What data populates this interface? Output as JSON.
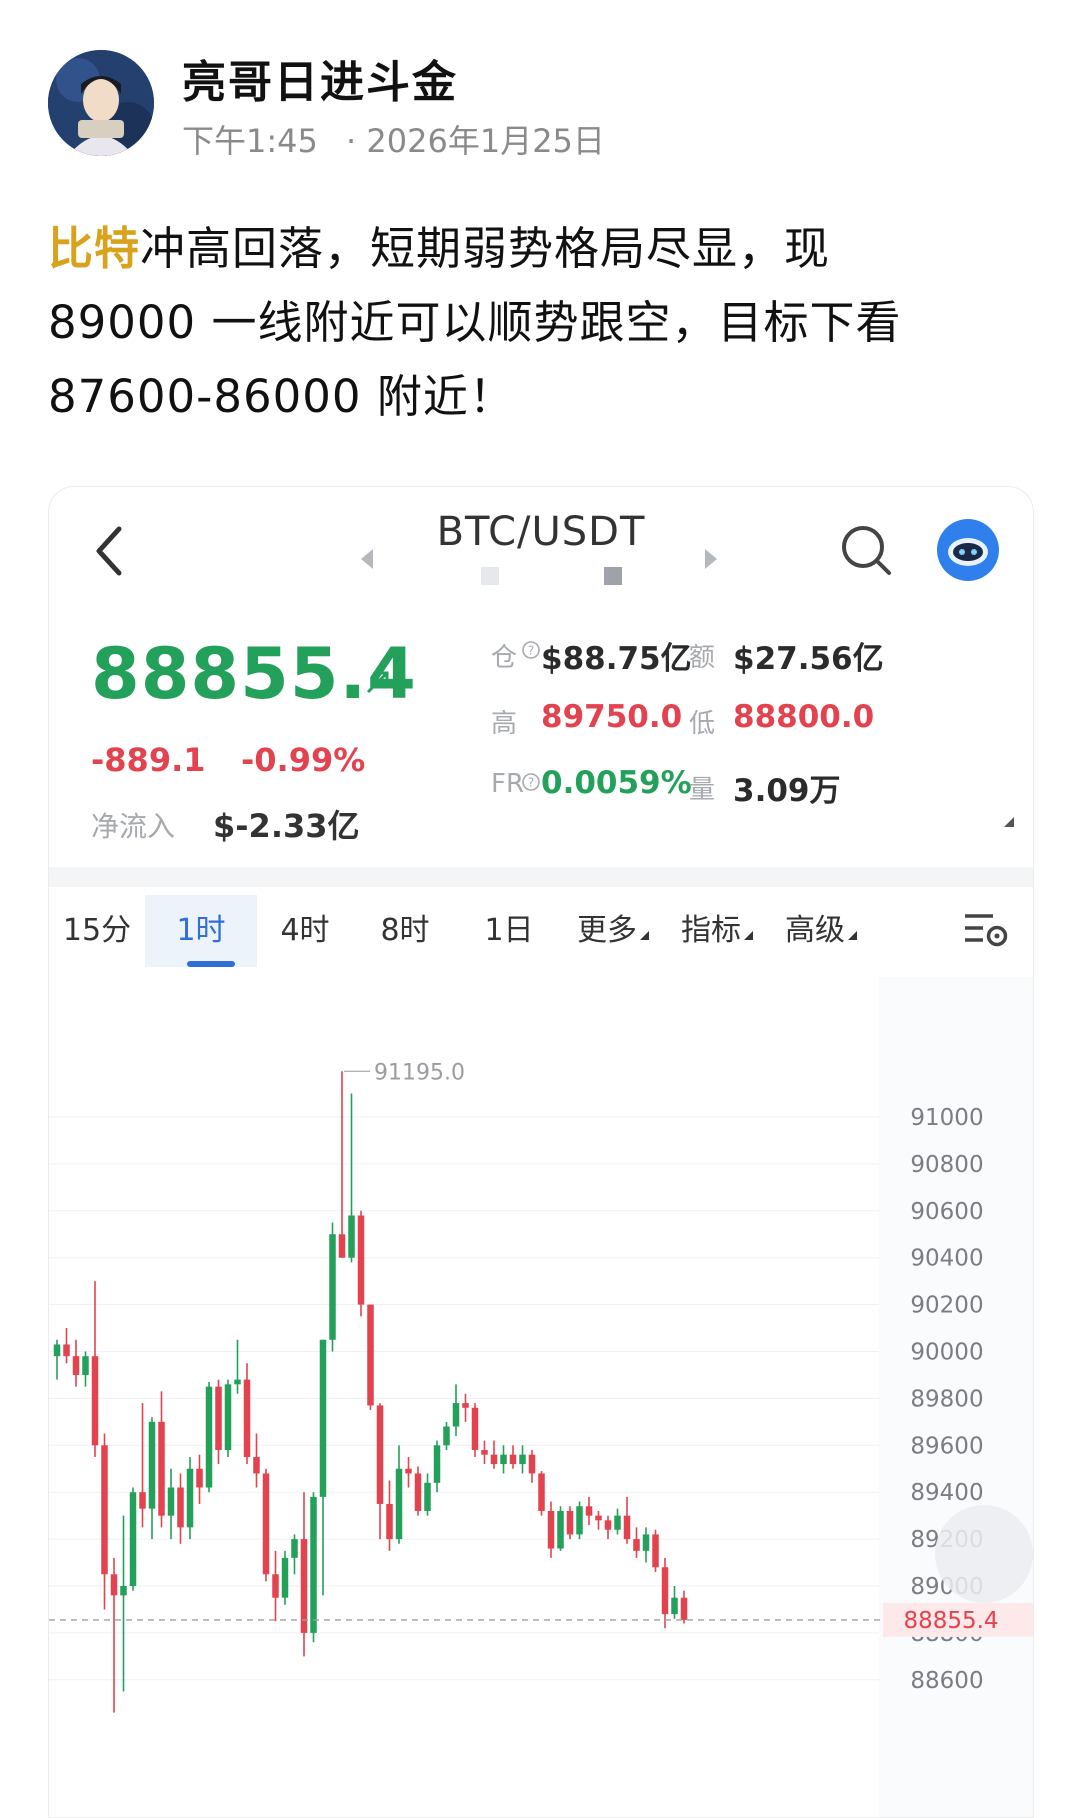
{
  "post": {
    "author": "亮哥日进斗金",
    "time": "下午1:45",
    "date": "· 2026年1月25日",
    "highlight": "比特",
    "body_line1": "冲高回落，短期弱势格局尽显，现",
    "body_line2": "89000 一线附近可以顺势跟空，目标下看",
    "body_line3": "87600-86000 附近！"
  },
  "ticker": {
    "pair": "BTC/USDT",
    "price": "88855.4",
    "change": "-889.1",
    "change_pct": "-0.99%",
    "netflow_label": "净流入",
    "netflow_value": "$-2.33亿",
    "oi_label": "仓",
    "oi_value": "$88.75亿",
    "turnover_label": "额",
    "turnover_value": "$27.56亿",
    "high_label": "高",
    "high_value": "89750.0",
    "low_label": "低",
    "low_value": "88800.0",
    "fr_label": "FR",
    "fr_value": "0.0059%",
    "vol_label": "量",
    "vol_value": "3.09万"
  },
  "tabs": [
    {
      "label": "15分"
    },
    {
      "label": "1时"
    },
    {
      "label": "4时"
    },
    {
      "label": "8时"
    },
    {
      "label": "1日"
    },
    {
      "label": "更多"
    },
    {
      "label": "指标"
    },
    {
      "label": "高级"
    }
  ],
  "active_tab": "1时",
  "colors": {
    "up": "#23a05a",
    "down": "#e2434f",
    "accent": "#2f6fd6",
    "highlight": "#d8a21c"
  },
  "chart_data": {
    "type": "candlestick",
    "yticks": [
      91000,
      90800,
      90600,
      90400,
      90200,
      90000,
      89800,
      89600,
      89400,
      89200,
      89000,
      88800,
      88600
    ],
    "ytick_labels": [
      "91000",
      "90800",
      "90600",
      "90400",
      "90200",
      "90000",
      "89800",
      "89600",
      "89400",
      "89200",
      "89000",
      "88800",
      "88600"
    ],
    "peak_label": "91195.0",
    "current_label": "88855.4",
    "current_price": 88855.4,
    "candles": [
      {
        "o": 89980,
        "h": 90050,
        "l": 89880,
        "c": 90030
      },
      {
        "o": 90030,
        "h": 90100,
        "l": 89950,
        "c": 89980
      },
      {
        "o": 89980,
        "h": 90050,
        "l": 89850,
        "c": 89900
      },
      {
        "o": 89900,
        "h": 90000,
        "l": 89850,
        "c": 89980
      },
      {
        "o": 89980,
        "h": 90300,
        "l": 89550,
        "c": 89600
      },
      {
        "o": 89600,
        "h": 89650,
        "l": 88900,
        "c": 89050
      },
      {
        "o": 89050,
        "h": 89120,
        "l": 88460,
        "c": 88960
      },
      {
        "o": 88960,
        "h": 89300,
        "l": 88550,
        "c": 89000
      },
      {
        "o": 89000,
        "h": 89420,
        "l": 88980,
        "c": 89400
      },
      {
        "o": 89400,
        "h": 89780,
        "l": 89250,
        "c": 89330
      },
      {
        "o": 89330,
        "h": 89720,
        "l": 89200,
        "c": 89700
      },
      {
        "o": 89700,
        "h": 89830,
        "l": 89250,
        "c": 89300
      },
      {
        "o": 89300,
        "h": 89500,
        "l": 89200,
        "c": 89420
      },
      {
        "o": 89420,
        "h": 89480,
        "l": 89180,
        "c": 89250
      },
      {
        "o": 89250,
        "h": 89550,
        "l": 89200,
        "c": 89500
      },
      {
        "o": 89500,
        "h": 89560,
        "l": 89350,
        "c": 89420
      },
      {
        "o": 89420,
        "h": 89870,
        "l": 89400,
        "c": 89850
      },
      {
        "o": 89850,
        "h": 89880,
        "l": 89520,
        "c": 89580
      },
      {
        "o": 89580,
        "h": 89880,
        "l": 89550,
        "c": 89860
      },
      {
        "o": 89860,
        "h": 90050,
        "l": 89820,
        "c": 89880
      },
      {
        "o": 89880,
        "h": 89950,
        "l": 89520,
        "c": 89550
      },
      {
        "o": 89550,
        "h": 89650,
        "l": 89420,
        "c": 89480
      },
      {
        "o": 89480,
        "h": 89500,
        "l": 89020,
        "c": 89050
      },
      {
        "o": 89050,
        "h": 89150,
        "l": 88850,
        "c": 88950
      },
      {
        "o": 88950,
        "h": 89150,
        "l": 88920,
        "c": 89120
      },
      {
        "o": 89120,
        "h": 89220,
        "l": 89050,
        "c": 89200
      },
      {
        "o": 89200,
        "h": 89400,
        "l": 88700,
        "c": 88800
      },
      {
        "o": 88800,
        "h": 89400,
        "l": 88760,
        "c": 89380
      },
      {
        "o": 89380,
        "h": 90050,
        "l": 88960,
        "c": 90050
      },
      {
        "o": 90050,
        "h": 90550,
        "l": 90000,
        "c": 90500
      },
      {
        "o": 90500,
        "h": 91195,
        "l": 90400,
        "c": 90400
      },
      {
        "o": 90400,
        "h": 91100,
        "l": 90380,
        "c": 90580
      },
      {
        "o": 90580,
        "h": 90600,
        "l": 90150,
        "c": 90200
      },
      {
        "o": 90200,
        "h": 90200,
        "l": 89750,
        "c": 89770
      },
      {
        "o": 89770,
        "h": 89780,
        "l": 89200,
        "c": 89350
      },
      {
        "o": 89350,
        "h": 89450,
        "l": 89150,
        "c": 89200
      },
      {
        "o": 89200,
        "h": 89600,
        "l": 89180,
        "c": 89500
      },
      {
        "o": 89500,
        "h": 89550,
        "l": 89420,
        "c": 89480
      },
      {
        "o": 89480,
        "h": 89510,
        "l": 89300,
        "c": 89320
      },
      {
        "o": 89320,
        "h": 89480,
        "l": 89300,
        "c": 89440
      },
      {
        "o": 89440,
        "h": 89620,
        "l": 89400,
        "c": 89600
      },
      {
        "o": 89600,
        "h": 89700,
        "l": 89580,
        "c": 89680
      },
      {
        "o": 89680,
        "h": 89860,
        "l": 89640,
        "c": 89780
      },
      {
        "o": 89780,
        "h": 89820,
        "l": 89700,
        "c": 89760
      },
      {
        "o": 89760,
        "h": 89780,
        "l": 89550,
        "c": 89580
      },
      {
        "o": 89580,
        "h": 89620,
        "l": 89520,
        "c": 89560
      },
      {
        "o": 89560,
        "h": 89620,
        "l": 89500,
        "c": 89520
      },
      {
        "o": 89520,
        "h": 89600,
        "l": 89480,
        "c": 89560
      },
      {
        "o": 89560,
        "h": 89600,
        "l": 89500,
        "c": 89520
      },
      {
        "o": 89520,
        "h": 89600,
        "l": 89480,
        "c": 89560
      },
      {
        "o": 89560,
        "h": 89580,
        "l": 89440,
        "c": 89480
      },
      {
        "o": 89480,
        "h": 89490,
        "l": 89300,
        "c": 89320
      },
      {
        "o": 89320,
        "h": 89360,
        "l": 89120,
        "c": 89160
      },
      {
        "o": 89160,
        "h": 89340,
        "l": 89150,
        "c": 89320
      },
      {
        "o": 89320,
        "h": 89340,
        "l": 89200,
        "c": 89220
      },
      {
        "o": 89220,
        "h": 89360,
        "l": 89200,
        "c": 89340
      },
      {
        "o": 89340,
        "h": 89380,
        "l": 89260,
        "c": 89300
      },
      {
        "o": 89300,
        "h": 89320,
        "l": 89240,
        "c": 89280
      },
      {
        "o": 89280,
        "h": 89300,
        "l": 89200,
        "c": 89240
      },
      {
        "o": 89240,
        "h": 89330,
        "l": 89220,
        "c": 89300
      },
      {
        "o": 89300,
        "h": 89380,
        "l": 89180,
        "c": 89200
      },
      {
        "o": 89200,
        "h": 89250,
        "l": 89120,
        "c": 89150
      },
      {
        "o": 89150,
        "h": 89250,
        "l": 89100,
        "c": 89220
      },
      {
        "o": 89220,
        "h": 89240,
        "l": 89060,
        "c": 89080
      },
      {
        "o": 89080,
        "h": 89120,
        "l": 88820,
        "c": 88880
      },
      {
        "o": 88880,
        "h": 89000,
        "l": 88860,
        "c": 88950
      },
      {
        "o": 88950,
        "h": 88980,
        "l": 88840,
        "c": 88855.4
      }
    ]
  }
}
